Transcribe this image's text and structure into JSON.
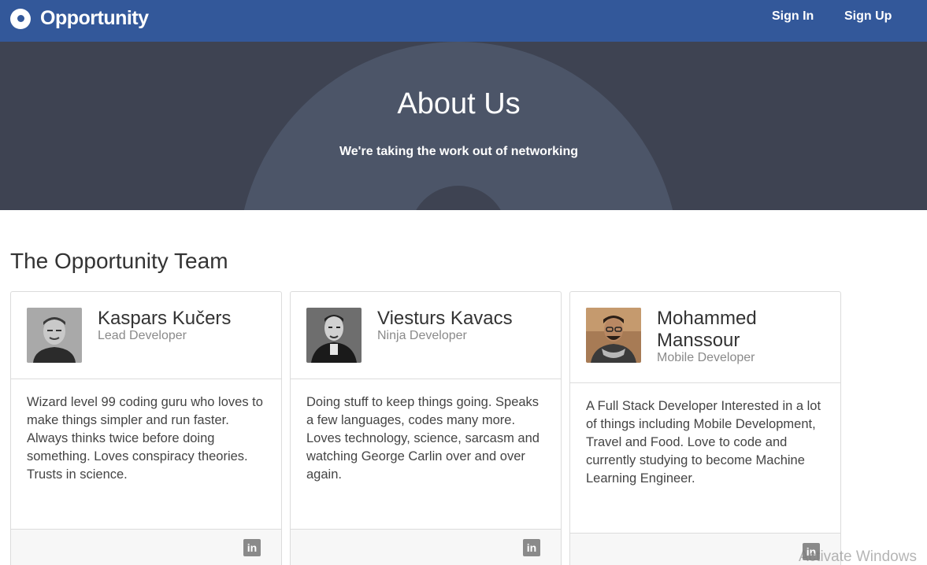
{
  "navbar": {
    "brand": "Opportunity",
    "sign_in": "Sign In",
    "sign_up": "Sign Up",
    "color": "#33589a"
  },
  "hero": {
    "title": "About Us",
    "subtitle": "We're taking the work out of networking"
  },
  "team": {
    "heading": "The Opportunity Team",
    "members": [
      {
        "name": "Kaspars Kučers",
        "role": "Lead Developer",
        "bio": "Wizard level 99 coding guru who loves to make things simpler and run faster. Always thinks twice before doing something. Loves conspiracy theories. Trusts in science.",
        "social_icon": "linkedin-icon",
        "social_label": "in"
      },
      {
        "name": "Viesturs Kavacs",
        "role": "Ninja Developer",
        "bio": "Doing stuff to keep things going. Speaks a few languages, codes many more. Loves technology, science, sarcasm and watching George Carlin over and over again.",
        "social_icon": "linkedin-icon",
        "social_label": "in"
      },
      {
        "name": "Mohammed Manssour",
        "role": "Mobile Developer",
        "bio": "A Full Stack Developer Interested in a lot of things including Mobile Development, Travel and Food. Love to code and currently studying to become Machine Learning Engineer.",
        "social_icon": "linkedin-icon",
        "social_label": "in"
      }
    ]
  },
  "overlay": {
    "watermark": "Activate Windows"
  }
}
